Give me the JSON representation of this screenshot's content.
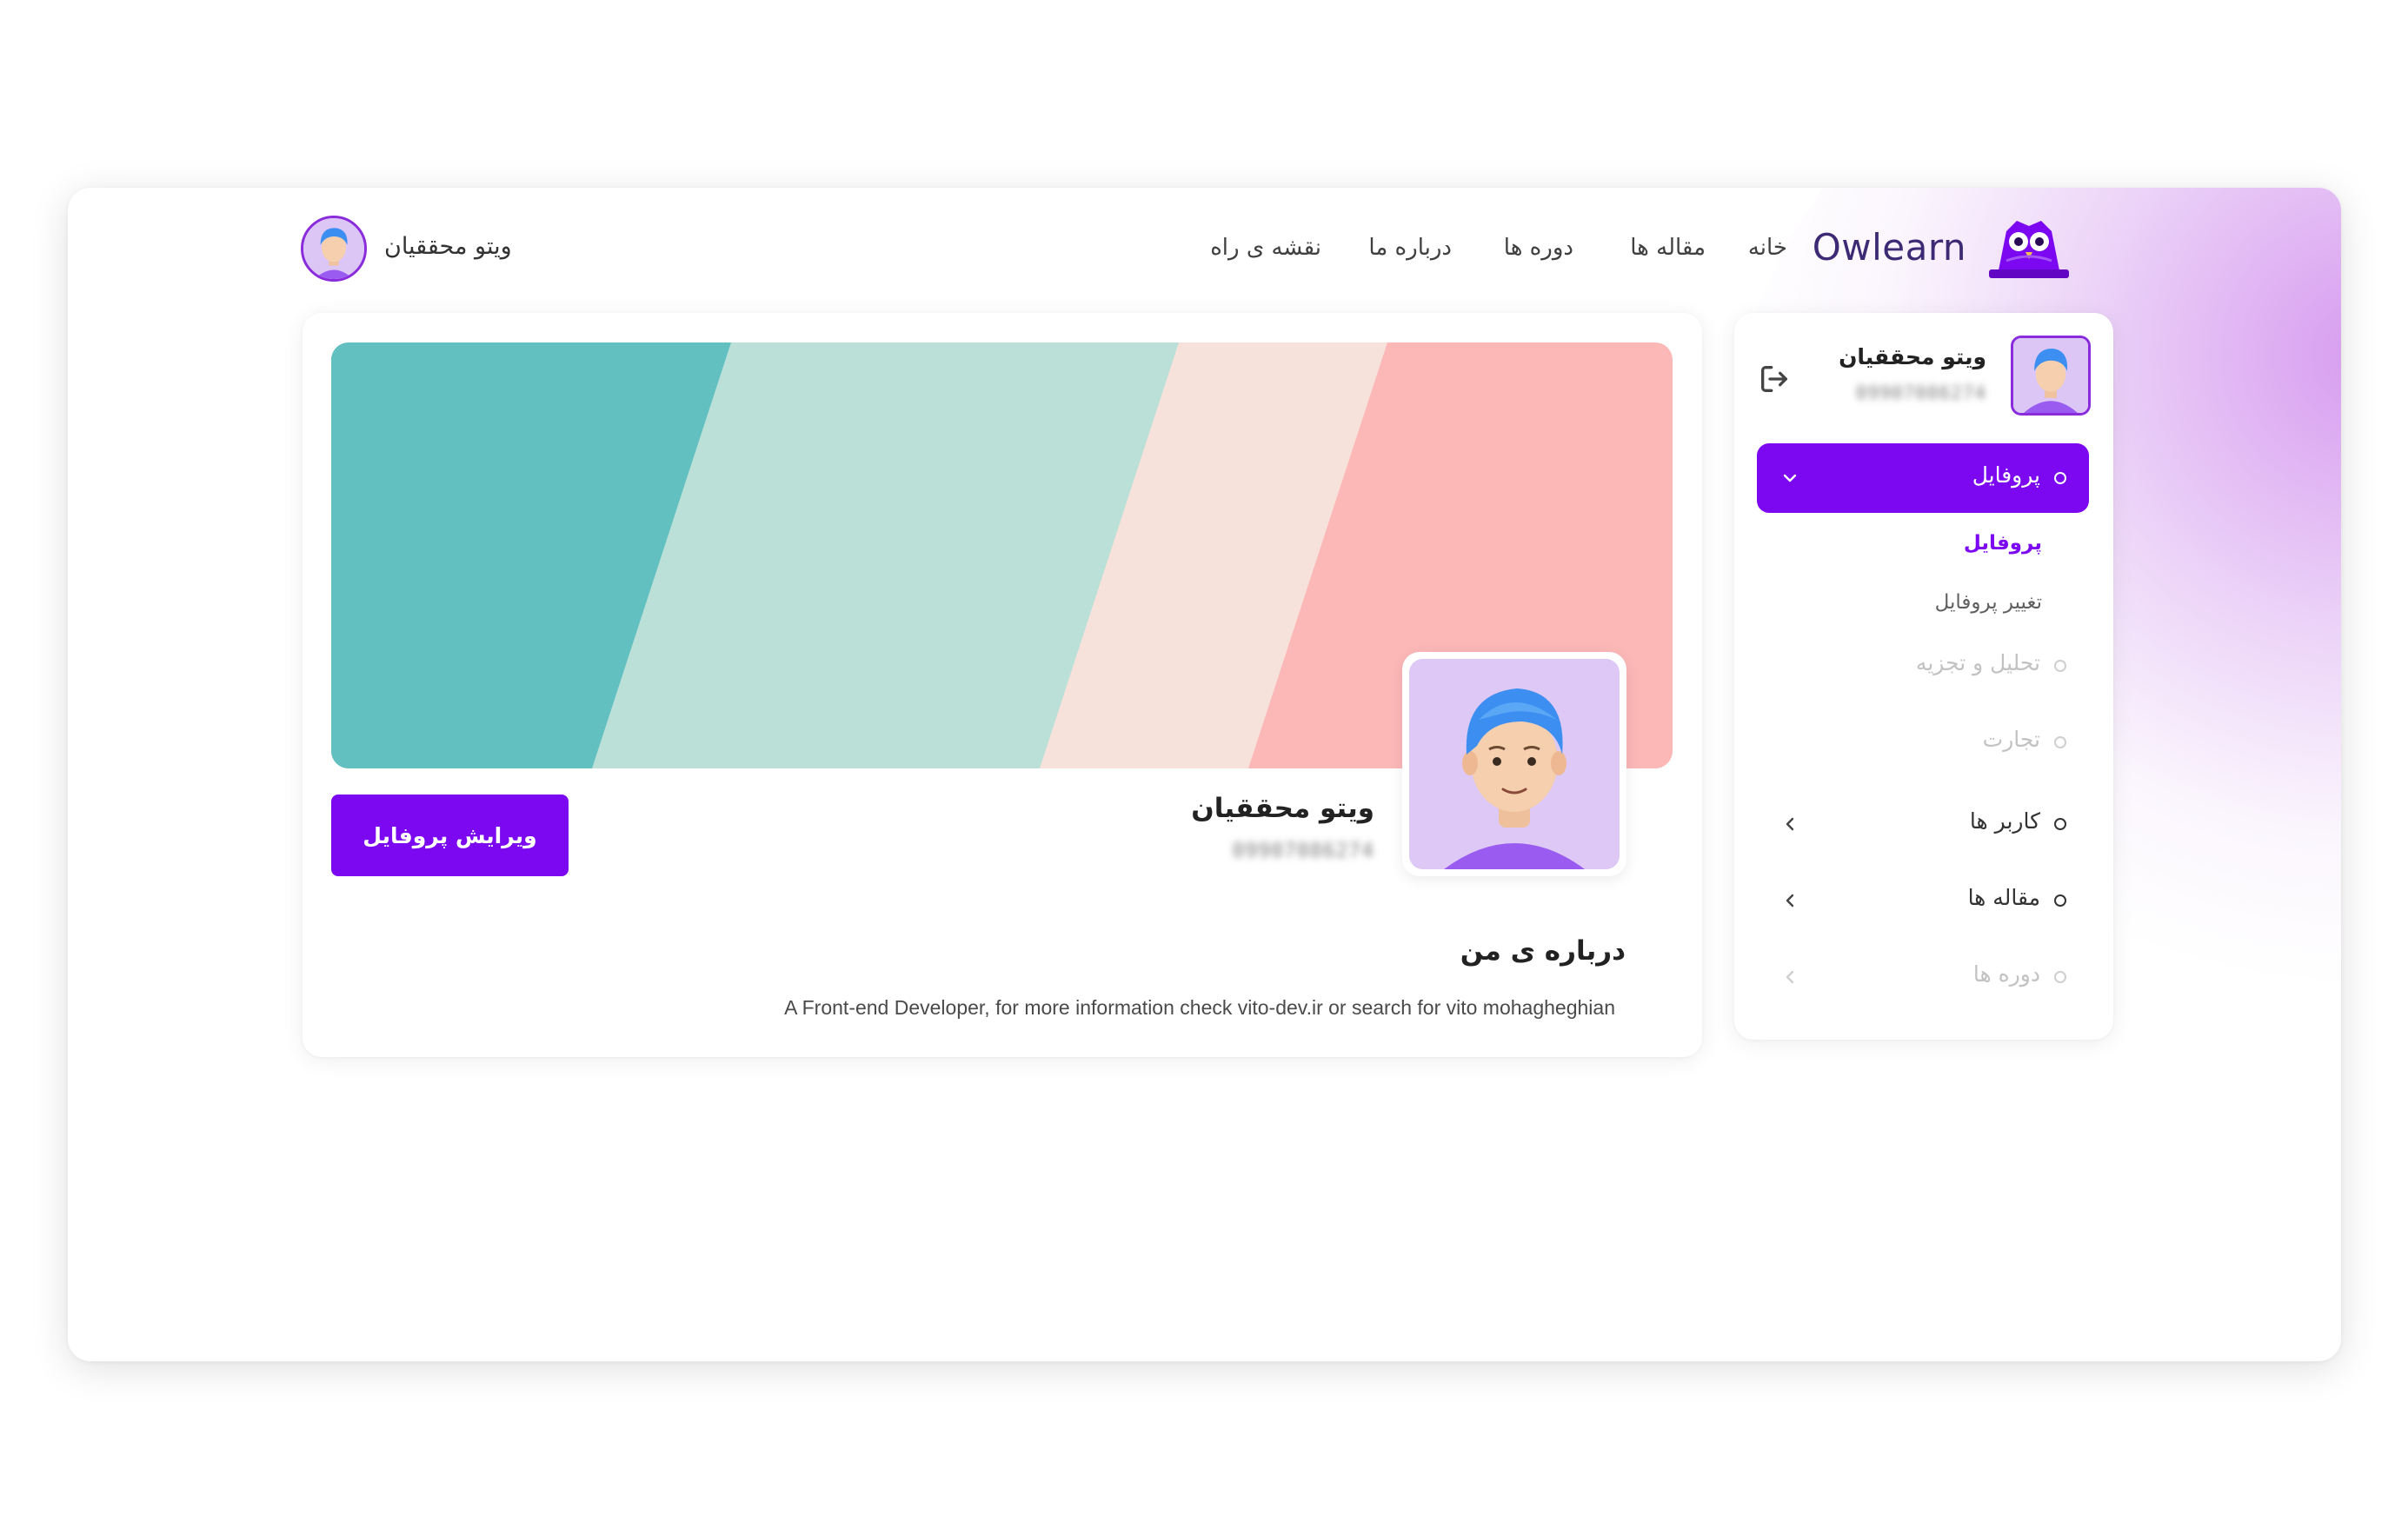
{
  "brand": {
    "name": "Owlearn"
  },
  "nav": {
    "items": [
      {
        "label": "خانه"
      },
      {
        "label": "مقاله ها"
      },
      {
        "label": "دوره ها"
      },
      {
        "label": "درباره ما"
      },
      {
        "label": "نقشه ی راه"
      }
    ]
  },
  "user": {
    "name": "ویتو محققیان",
    "phone": "09907086274"
  },
  "sidebar": {
    "active_item": "پروفایل",
    "sub_items": [
      {
        "label": "پروفایل",
        "active": true
      },
      {
        "label": "تغییر پروفایل",
        "active": false
      }
    ],
    "items": [
      {
        "label": "تحلیل و تجزیه",
        "disabled": true
      },
      {
        "label": "تجارت",
        "disabled": true
      },
      {
        "label": "کاربر ها",
        "disabled": false
      },
      {
        "label": "مقاله ها",
        "disabled": false
      },
      {
        "label": "دوره ها",
        "disabled": true
      }
    ]
  },
  "profile": {
    "edit_button": "ویرایش پروفایل",
    "about_title": "درباره ی من",
    "about_text": "A Front-end Developer, for more information check vito-dev.ir or search for vito mohagheghian"
  },
  "colors": {
    "accent": "#7b08f0",
    "cover_teal": "#62c0c1",
    "cover_mint": "#bbe0d8",
    "cover_peach": "#f7e2db",
    "cover_pink": "#fcb7b7",
    "avatar_bg": "#ddc8f6"
  },
  "icons": [
    "owl-logo-icon",
    "logout-icon",
    "chevron-down-icon",
    "chevron-left-icon"
  ]
}
